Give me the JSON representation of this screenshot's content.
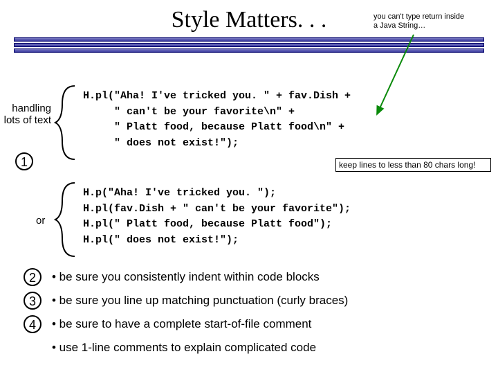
{
  "title": "Style Matters. . .",
  "annotations": {
    "top": "you can't type return inside a Java String…",
    "right": "keep lines to less than 80 chars long!"
  },
  "labels": {
    "handling": "handling lots of text",
    "or": "or"
  },
  "numbers": {
    "n1": "1",
    "n2": "2",
    "n3": "3",
    "n4": "4"
  },
  "code": {
    "block1": "H.pl(\"Aha! I've tricked you. \" + fav.Dish +\n     \" can't be your favorite\\n\" +\n     \" Platt food, because Platt food\\n\" +\n     \" does not exist!\");",
    "block2": "H.p(\"Aha! I've tricked you. \");\nH.pl(fav.Dish + \" can't be your favorite\");\nH.pl(\" Platt food, because Platt food\");\nH.pl(\" does not exist!\");"
  },
  "bullets": {
    "b1": "• be sure you consistently indent within code blocks",
    "b2": "• be sure you line up matching punctuation (curly braces)",
    "b3": "• be sure to have a complete start-of-file comment",
    "b4": "• use 1-line comments to explain complicated code"
  }
}
